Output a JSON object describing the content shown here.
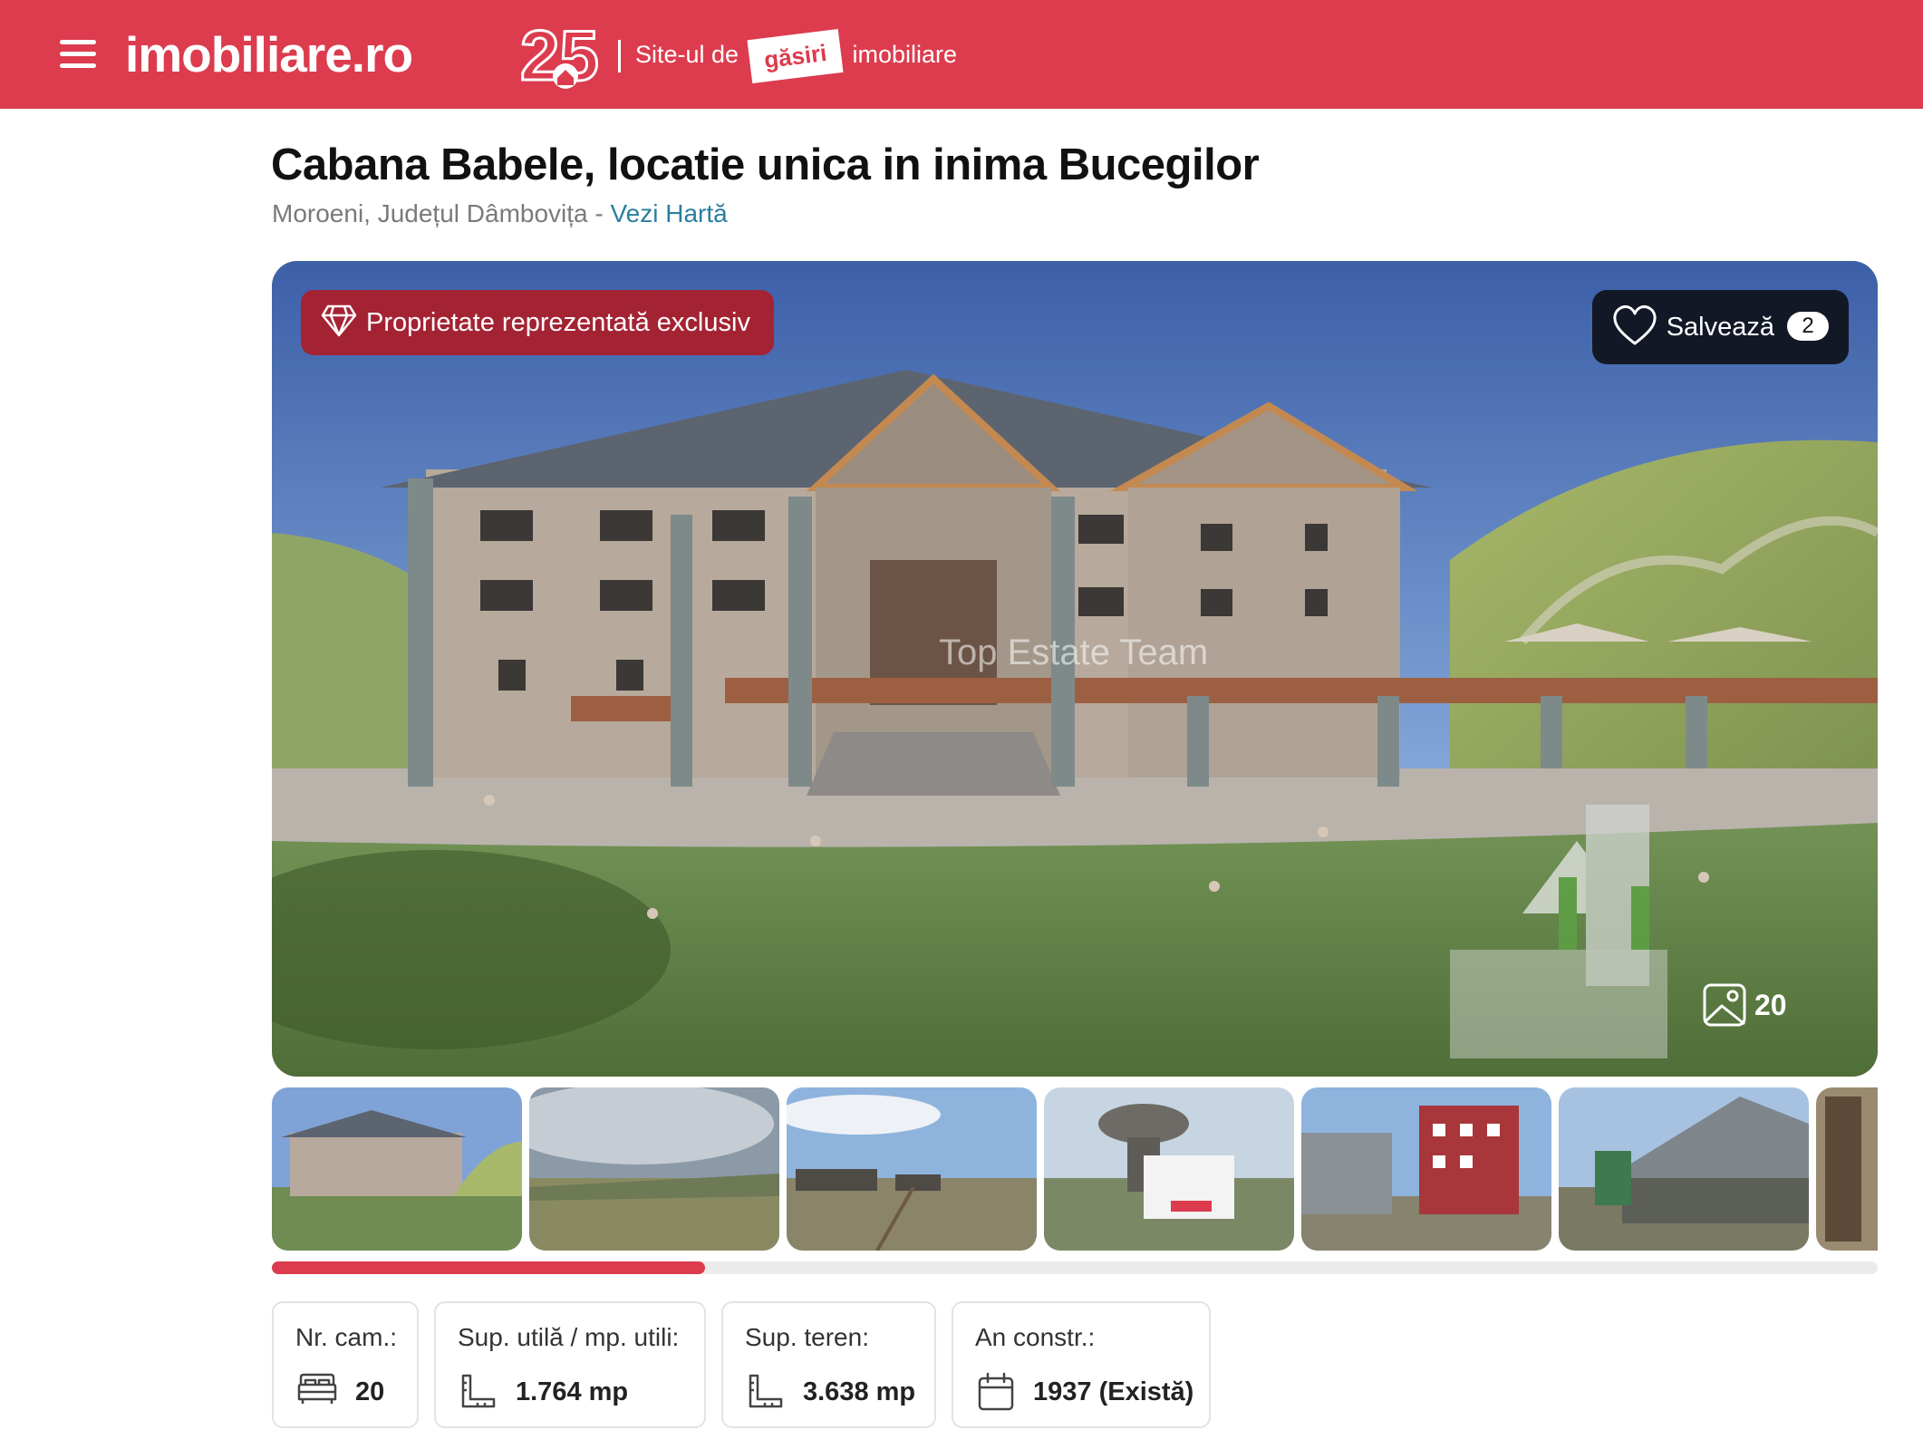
{
  "header": {
    "logo": "imobiliare.ro",
    "anniversary": "25",
    "tagline_prefix": "Site-ul de",
    "tagline_highlight": "găsiri",
    "tagline_suffix": "imobiliare"
  },
  "listing": {
    "title": "Cabana Babele, locatie unica in inima Bucegilor",
    "location": "Moroeni, Județul Dâmbovița",
    "separator": " - ",
    "map_link": "Vezi Hartă"
  },
  "gallery": {
    "exclusive_badge": "Proprietate reprezentată exclusiv",
    "save_label": "Salvează",
    "save_count": "2",
    "watermark": "Top Estate Team",
    "photo_count": "20",
    "progress_fraction": 0.27
  },
  "features": [
    {
      "label": "Nr. cam.:",
      "value": "20",
      "icon": "bed-icon"
    },
    {
      "label": "Sup. utilă / mp. utili:",
      "value": "1.764 mp",
      "icon": "area-ruler-icon"
    },
    {
      "label": "Sup. teren:",
      "value": "3.638 mp",
      "icon": "land-ruler-icon"
    },
    {
      "label": "An constr.:",
      "value": "1937 (Există)",
      "icon": "calendar-icon"
    }
  ],
  "colors": {
    "brand": "#dc3c4e",
    "exclusive_badge": "#a42333",
    "save_button": "#121826",
    "link": "#2b7e9f"
  }
}
